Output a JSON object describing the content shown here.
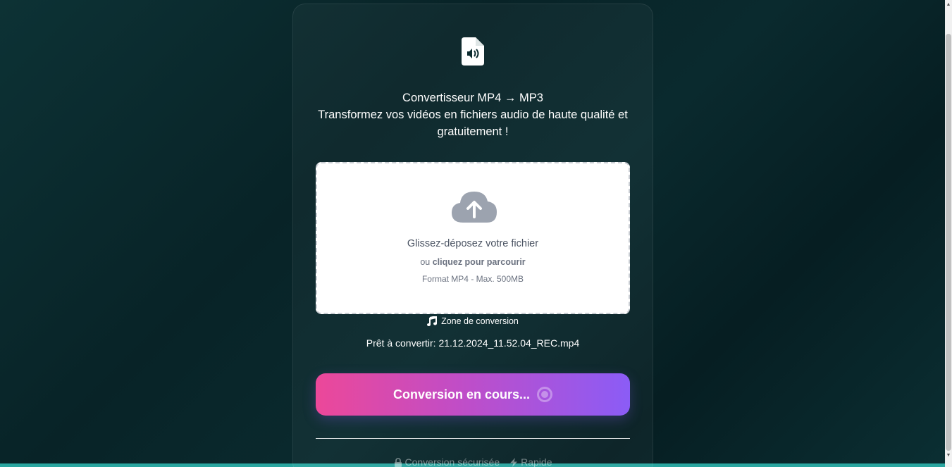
{
  "header": {
    "logo_icon": "file-audio-icon",
    "title": "Convertisseur MP4 → MP3",
    "subtitle": "Transformez vos vidéos en fichiers audio de haute qualité et gratuitement !"
  },
  "dropzone": {
    "icon": "cloud-upload-icon",
    "main_text": "Glissez-déposez votre fichier",
    "or_text": "ou",
    "browse_text": "cliquez pour parcourir",
    "format_text": "Format MP4 - Max. 500MB"
  },
  "zone_label": {
    "icon": "music-note-icon",
    "text": "Zone de conversion"
  },
  "status": {
    "ready_text": "Prêt à convertir: 21.12.2024_11.52.04_REC.mp4"
  },
  "convert_button": {
    "label": "Conversion en cours...",
    "icon": "spinner-icon"
  },
  "features": [
    {
      "icon": "lock-icon",
      "label": "Conversion sécurisée"
    },
    {
      "icon": "bolt-icon",
      "label": "Rapide"
    }
  ],
  "colors": {
    "button_gradient_start": "#ec4899",
    "button_gradient_end": "#8b5cf6",
    "background": "#082327"
  }
}
